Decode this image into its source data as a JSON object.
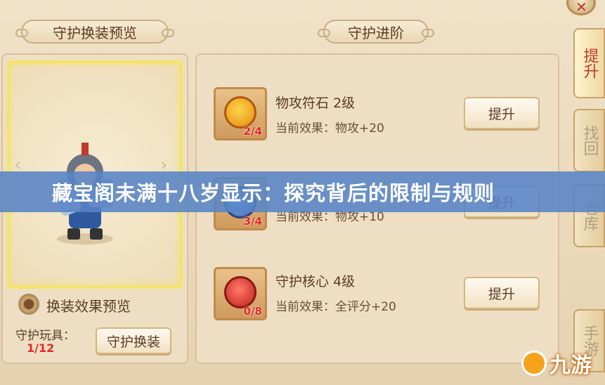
{
  "left_panel": {
    "title": "守护换装预览",
    "preview_toggle_label": "换装效果预览",
    "toy_label": "守护玩具：",
    "toy_count": "1/12",
    "swap_button": "守护换装"
  },
  "right_panel": {
    "title": "守护进阶",
    "items": [
      {
        "name": "物攻符石",
        "level": "2级",
        "effect_prefix": "当前效果：",
        "effect": "物攻+20",
        "count": "2/4",
        "button": "提升",
        "icon": "orange-shield-gem-icon"
      },
      {
        "name": "",
        "level": "",
        "effect_prefix": "当前效果：",
        "effect": "物攻+10",
        "count": "3/4",
        "button": "提升",
        "icon": "blue-orb-icon"
      },
      {
        "name": "守护核心",
        "level": "4级",
        "effect_prefix": "当前效果：",
        "effect": "全评分+20",
        "count": "0/8",
        "button": "提升",
        "icon": "red-core-gem-icon"
      }
    ]
  },
  "side_tabs": [
    "提升",
    "找回",
    "仓库",
    "手游"
  ],
  "banner": "藏宝阁未满十八岁显示：探究背后的限制与规则",
  "watermark": "九游",
  "colors": {
    "banner": "#5684c6",
    "count_red": "#e02828",
    "highlight": "#f4e36a"
  }
}
